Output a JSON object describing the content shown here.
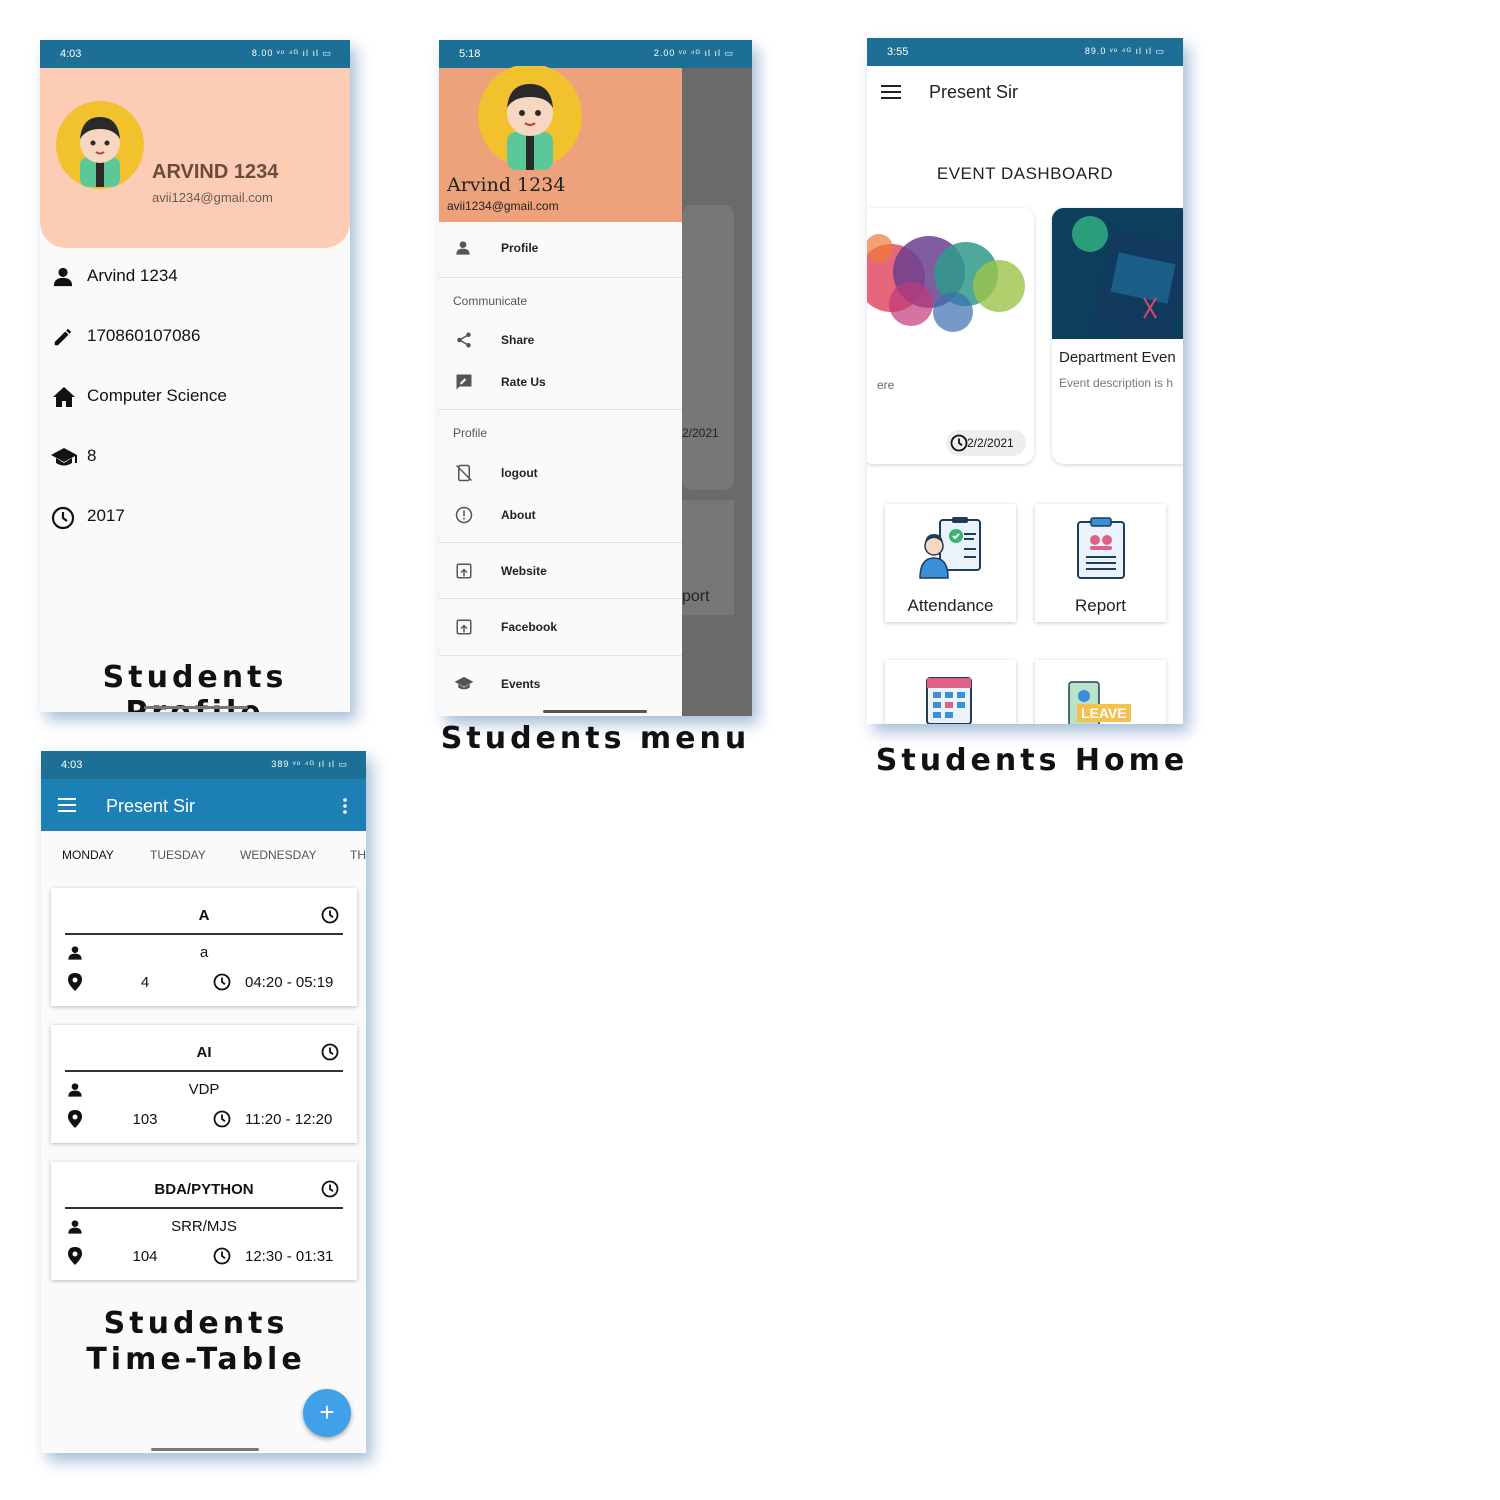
{
  "captions": {
    "profile": "Students Profile",
    "menu": "Students menu",
    "home": "Students Home",
    "timetable_line1": "Students",
    "timetable_line2": "Time-Table"
  },
  "colors": {
    "status_bar": "#1d6f95",
    "app_bar": "#1d80b5",
    "profile_header": "#fccdb4",
    "drawer_header": "#eea27b",
    "fab": "#40a0e8"
  },
  "profile_screen": {
    "status": {
      "time": "4:03",
      "icons": "8.00 ᵛᵒ ⁴ᴳ ıl ıl ▭"
    },
    "name": "ARVIND 1234",
    "email": "avii1234@gmail.com",
    "rows": [
      {
        "icon": "person-icon",
        "value": "Arvind 1234"
      },
      {
        "icon": "pencil-icon",
        "value": "170860107086"
      },
      {
        "icon": "home-icon",
        "value": "Computer Science"
      },
      {
        "icon": "school-icon",
        "value": "8"
      },
      {
        "icon": "clock-icon",
        "value": "2017"
      }
    ]
  },
  "menu_screen": {
    "status": {
      "time": "5:18",
      "icons": "2.00 ᵛᵒ ⁴ᴳ ıl ıl ▭"
    },
    "name": "Arvind 1234",
    "email": "avii1234@gmail.com",
    "items": {
      "profile": "Profile",
      "communicate_section": "Communicate",
      "share": "Share",
      "rate_us": "Rate Us",
      "profile_section": "Profile",
      "logout": "logout",
      "about": "About",
      "website": "Website",
      "facebook": "Facebook",
      "events": "Events"
    },
    "behind": {
      "date": "2/2021",
      "report": "port"
    }
  },
  "home_screen": {
    "status": {
      "time": "3:55",
      "icons": "89.0 ᵛᵒ ⁴ᴳ ıl ıl ▭"
    },
    "title": "Present Sir",
    "section_title": "EVENT DASHBOARD",
    "events": [
      {
        "desc_fragment": "ere",
        "date": "2/2/2021"
      },
      {
        "title": "Department Even",
        "desc": "Event description is h"
      }
    ],
    "tiles": {
      "attendance": "Attendance",
      "report": "Report",
      "leave": "LEAVE"
    }
  },
  "timetable_screen": {
    "status": {
      "time": "4:03",
      "icons": "389 ᵛᵒ ⁴ᴳ ıl ıl ▭"
    },
    "title": "Present Sir",
    "tabs": [
      "MONDAY",
      "TUESDAY",
      "WEDNESDAY",
      "TH"
    ],
    "classes": [
      {
        "subject": "A",
        "teacher": "a",
        "room": "4",
        "time": "04:20 - 05:19"
      },
      {
        "subject": "AI",
        "teacher": "VDP",
        "room": "103",
        "time": "11:20 - 12:20"
      },
      {
        "subject": "BDA/PYTHON",
        "teacher": "SRR/MJS",
        "room": "104",
        "time": "12:30 - 01:31"
      }
    ],
    "fab": "+"
  }
}
